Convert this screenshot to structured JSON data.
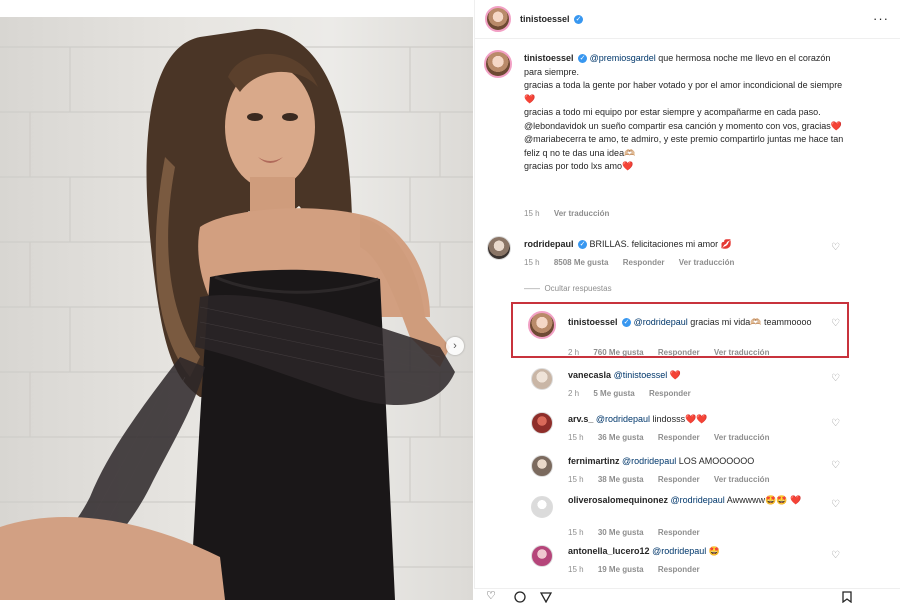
{
  "header": {
    "username": "tinistoessel",
    "verified_glyph": "✓",
    "more_glyph": "···"
  },
  "photo": {
    "next_glyph": "›"
  },
  "caption": {
    "username": "tinistoessel",
    "mention": "@premiosgardel",
    "lines": [
      " que hermosa noche me llevo en el corazón para siempre.",
      "gracias a toda la gente por haber votado y por el amor incondicional de siempre",
      "gracias a todo mi equipo por estar siempre y acompañarme en cada paso.",
      "@lebondavidok un sueño compartir esa canción y momento con vos, gracias",
      "@mariabecerra te amo, te admiro, y este premio compartirlo juntas me hace tan feliz q no te das una idea🫶🏼",
      "gracias por todo lxs amo"
    ],
    "heart": "❤️",
    "time": "15 h",
    "translate": "Ver traducción"
  },
  "comments": [
    {
      "username": "rodridepaul",
      "verified": true,
      "text": "BRILLAS. felicitaciones mi amor 💋",
      "time": "15 h",
      "likes": "8508 Me gusta",
      "reply": "Responder",
      "translate": "Ver traducción"
    }
  ],
  "hide_replies": "Ocultar respuestas",
  "replies": [
    {
      "username": "tinistoessel",
      "verified": true,
      "mention": "@rodridepaul",
      "text": " gracias mi vida🫶🏼 teammoooo",
      "time": "2 h",
      "likes": "760 Me gusta",
      "reply": "Responder",
      "translate": "Ver traducción"
    },
    {
      "username": "vanecasla",
      "mention": "@tinistoessel",
      "text": " ❤️",
      "time": "2 h",
      "likes": "5 Me gusta",
      "reply": "Responder"
    },
    {
      "username": "arv.s_",
      "mention": "@rodridepaul",
      "text": " lindosss❤️❤️",
      "time": "15 h",
      "likes": "36 Me gusta",
      "reply": "Responder",
      "translate": "Ver traducción"
    },
    {
      "username": "fernimartinz",
      "mention": "@rodridepaul",
      "text": " LOS AMOOOOOO",
      "time": "15 h",
      "likes": "38 Me gusta",
      "reply": "Responder",
      "translate": "Ver traducción"
    },
    {
      "username": "oliverosalomequinonez",
      "mention": "@rodridepaul",
      "text": " Awwwww🤩🤩 ❤️",
      "time": "15 h",
      "likes": "30 Me gusta",
      "reply": "Responder"
    },
    {
      "username": "antonella_lucero12",
      "mention": "@rodridepaul",
      "text": " 🤩",
      "time": "15 h",
      "likes": "19 Me gusta",
      "reply": "Responder"
    }
  ],
  "icons": {
    "heart_outline": "♡",
    "like_icon": "heart-outline",
    "comment_icon": "comment-bubble",
    "share_icon": "paper-plane",
    "save_icon": "bookmark"
  },
  "colors": {
    "highlight_border": "#c8323c",
    "verified_blue": "#3897f0",
    "mention_blue": "#00376b",
    "meta_gray": "#8e8e8e"
  }
}
